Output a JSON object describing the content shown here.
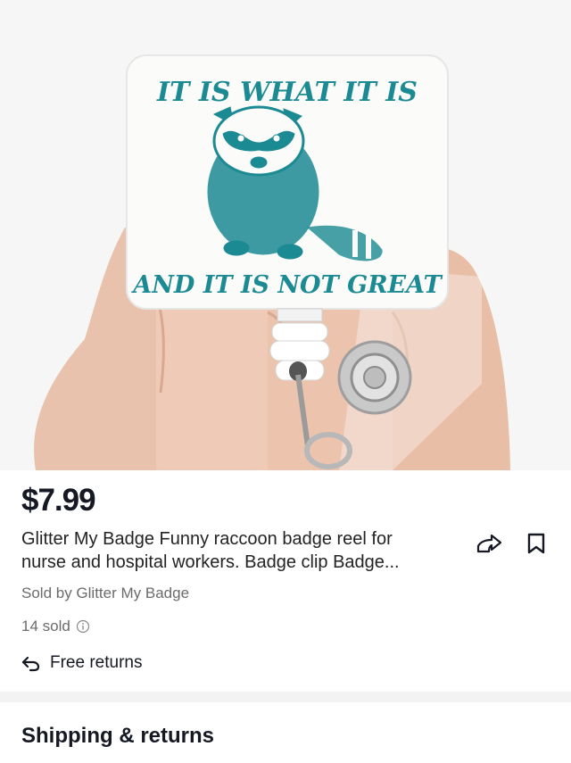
{
  "product_image": {
    "alt": "Raccoon badge reel held in a hand",
    "badge_top_text": "IT IS WHAT IT IS",
    "badge_bottom_text": "AND IT IS NOT GREAT",
    "accent_color": "#1c8a93"
  },
  "product": {
    "price": "$7.99",
    "title_line1": "Glitter My Badge Funny raccoon badge reel for",
    "title_line2": "nurse and hospital workers. Badge clip Badge...",
    "seller": "Sold by Glitter My Badge",
    "sold_count": "14 sold",
    "returns_label": "Free returns"
  },
  "actions": {
    "share_icon": "share-arrow-icon",
    "save_icon": "bookmark-icon"
  },
  "shipping": {
    "section_title": "Shipping & returns"
  }
}
